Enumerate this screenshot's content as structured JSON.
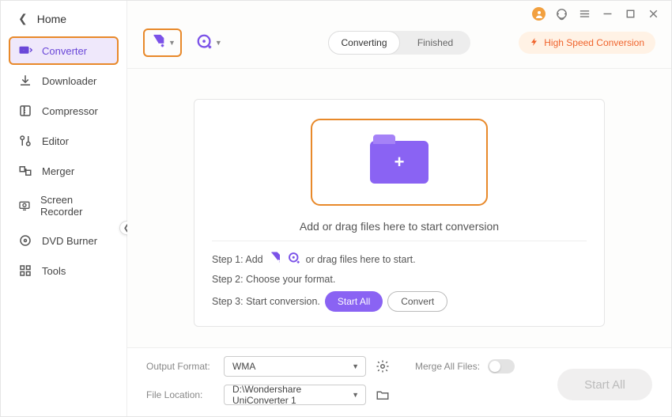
{
  "header": {
    "home": "Home"
  },
  "sidebar": {
    "items": [
      {
        "label": "Converter",
        "icon": "converter"
      },
      {
        "label": "Downloader",
        "icon": "downloader"
      },
      {
        "label": "Compressor",
        "icon": "compressor"
      },
      {
        "label": "Editor",
        "icon": "editor"
      },
      {
        "label": "Merger",
        "icon": "merger"
      },
      {
        "label": "Screen Recorder",
        "icon": "screen-recorder"
      },
      {
        "label": "DVD Burner",
        "icon": "dvd-burner"
      },
      {
        "label": "Tools",
        "icon": "tools"
      }
    ],
    "selectedIndex": 0
  },
  "toolbar": {
    "tabs": {
      "converting": "Converting",
      "finished": "Finished",
      "activeIndex": 0
    },
    "high_speed_label": "High Speed Conversion"
  },
  "drop": {
    "message": "Add or drag files here to start conversion",
    "step1_prefix": "Step 1: Add",
    "step1_suffix": "or drag files here to start.",
    "step2": "Step 2: Choose your format.",
    "step3": "Step 3: Start conversion.",
    "startall_small": "Start All",
    "convert_small": "Convert"
  },
  "bottom": {
    "output_label": "Output Format:",
    "output_value": "WMA",
    "merge_label": "Merge All Files:",
    "merge_on": false,
    "location_label": "File Location:",
    "location_value": "D:\\Wondershare UniConverter 1",
    "startall_label": "Start All"
  }
}
